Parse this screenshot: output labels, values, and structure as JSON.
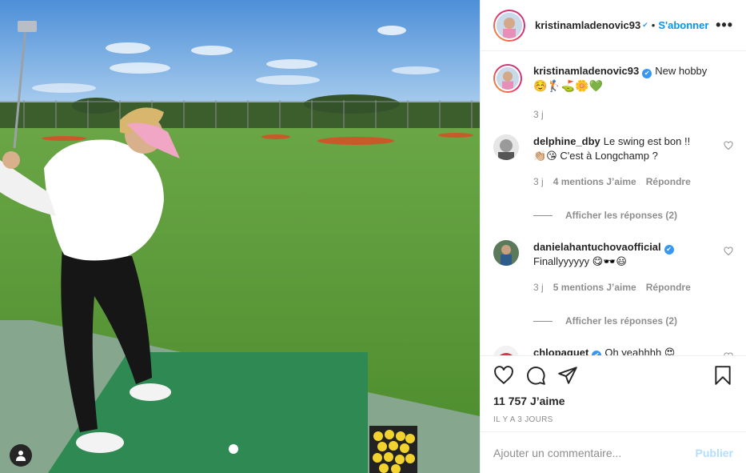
{
  "post": {
    "author": "kristinamladenovic93",
    "follow_label": "S'abonner",
    "separator": "•",
    "more_label": "•••",
    "caption": "New hobby",
    "caption_emojis": "☺️🏌️⛳🌼💚",
    "caption_time": "3 j",
    "likes": "11 757 J’aime",
    "date": "IL Y A 3 JOURS"
  },
  "comments": [
    {
      "user": "delphine_dby",
      "verified": false,
      "text": "Le swing est bon !!",
      "text2": "👏🏼😘 C'est à Longchamp ?",
      "time": "3 j",
      "likes": "4 mentions J’aime",
      "reply_label": "Répondre",
      "view_replies": "Afficher les réponses (2)"
    },
    {
      "user": "danielahantuchovaofficial",
      "verified": true,
      "text": "Finallyyyyyy 😋🕶️😃",
      "time": "3 j",
      "likes": "5 mentions J’aime",
      "reply_label": "Répondre",
      "view_replies": "Afficher les réponses (2)"
    },
    {
      "user": "chlopaquet",
      "verified": true,
      "text": "Oh yeahhhh 😍"
    }
  ],
  "composer": {
    "placeholder": "Ajouter un commentaire...",
    "post_label": "Publier"
  },
  "icons": {
    "like": "heart-icon",
    "comment": "comment-icon",
    "share": "paper-plane-icon",
    "save": "bookmark-icon",
    "tag": "user-tag-icon"
  },
  "colors": {
    "accent": "#0095f6",
    "verified": "#3897f0",
    "post_disabled": "#b2dffc"
  }
}
